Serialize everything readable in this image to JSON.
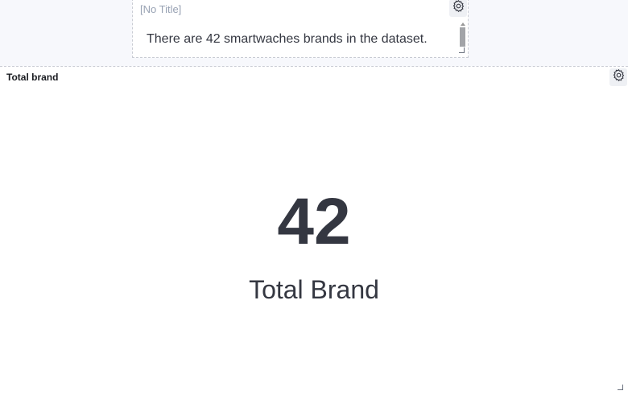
{
  "top_panel": {
    "title": "[No Title]",
    "text": "There are 42 smartwaches brands in the dataset.",
    "settings_icon": "gear-icon"
  },
  "metric_panel": {
    "title": "Total brand",
    "value": "42",
    "label": "Total Brand",
    "settings_icon": "gear-icon"
  },
  "colors": {
    "page_background": "#f7f8fc",
    "panel_background": "#ffffff",
    "text_primary": "#343741",
    "text_placeholder": "#98a2b3"
  }
}
